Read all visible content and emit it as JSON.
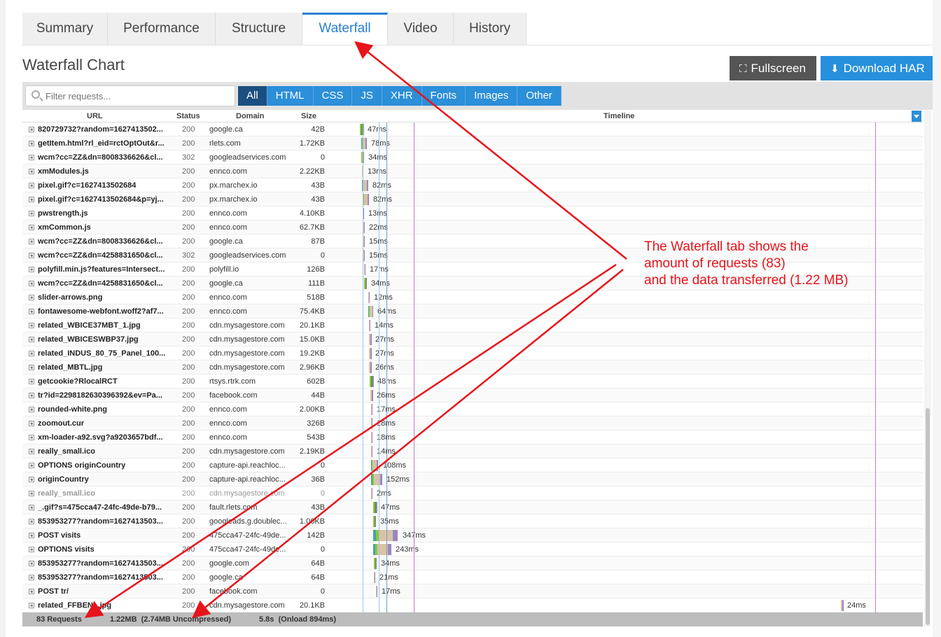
{
  "tabs": [
    {
      "label": "Summary",
      "active": false
    },
    {
      "label": "Performance",
      "active": false
    },
    {
      "label": "Structure",
      "active": false
    },
    {
      "label": "Waterfall",
      "active": true
    },
    {
      "label": "Video",
      "active": false
    },
    {
      "label": "History",
      "active": false
    }
  ],
  "page_title": "Waterfall Chart",
  "buttons": {
    "fullscreen": "Fullscreen",
    "download_har": "Download HAR"
  },
  "filter": {
    "placeholder": "Filter requests...",
    "types": [
      "All",
      "HTML",
      "CSS",
      "JS",
      "XHR",
      "Fonts",
      "Images",
      "Other"
    ],
    "active": "All"
  },
  "columns": {
    "url": "URL",
    "status": "Status",
    "domain": "Domain",
    "size": "Size",
    "timeline": "Timeline"
  },
  "requests": [
    {
      "url": "820729732?random=1627413502...",
      "status": "200",
      "domain": "google.ca",
      "size": "42B",
      "start": 0.05,
      "duration": "47ms"
    },
    {
      "url": "getItem.html?rl_eid=rctOptOut&r...",
      "status": "200",
      "domain": "rlets.com",
      "size": "1.72KB",
      "start": 0.052,
      "duration": "78ms"
    },
    {
      "url": "wcm?cc=ZZ&dn=8008336626&cl...",
      "status": "302",
      "domain": "googleadservices.com",
      "size": "0",
      "start": 0.052,
      "duration": "34ms"
    },
    {
      "url": "xmModules.js",
      "status": "200",
      "domain": "ennco.com",
      "size": "2.22KB",
      "start": 0.053,
      "duration": "13ms"
    },
    {
      "url": "pixel.gif?c=1627413502684",
      "status": "200",
      "domain": "px.marchex.io",
      "size": "43B",
      "start": 0.053,
      "duration": "82ms"
    },
    {
      "url": "pixel.gif?c=1627413502684&p=yj...",
      "status": "200",
      "domain": "px.marchex.io",
      "size": "43B",
      "start": 0.054,
      "duration": "82ms"
    },
    {
      "url": "pwstrength.js",
      "status": "200",
      "domain": "ennco.com",
      "size": "4.10KB",
      "start": 0.054,
      "duration": "13ms"
    },
    {
      "url": "xmCommon.js",
      "status": "200",
      "domain": "ennco.com",
      "size": "62.7KB",
      "start": 0.055,
      "duration": "22ms"
    },
    {
      "url": "wcm?cc=ZZ&dn=8008336626&cl...",
      "status": "200",
      "domain": "google.ca",
      "size": "87B",
      "start": 0.055,
      "duration": "15ms"
    },
    {
      "url": "wcm?cc=ZZ&dn=4258831650&cl...",
      "status": "302",
      "domain": "googleadservices.com",
      "size": "0",
      "start": 0.055,
      "duration": "15ms"
    },
    {
      "url": "polyfill.min.js?features=Intersect...",
      "status": "200",
      "domain": "polyfill.io",
      "size": "126B",
      "start": 0.057,
      "duration": "17ms"
    },
    {
      "url": "wcm?cc=ZZ&dn=4258831650&cl...",
      "status": "200",
      "domain": "google.ca",
      "size": "111B",
      "start": 0.057,
      "duration": "34ms"
    },
    {
      "url": "slider-arrows.png",
      "status": "200",
      "domain": "ennco.com",
      "size": "518B",
      "start": 0.064,
      "duration": "12ms"
    },
    {
      "url": "fontawesome-webfont.woff2?af7...",
      "status": "200",
      "domain": "ennco.com",
      "size": "75.4KB",
      "start": 0.064,
      "duration": "64ms"
    },
    {
      "url": "related_WBICE37MBT_1.jpg",
      "status": "200",
      "domain": "cdn.mysagestore.com",
      "size": "20.1KB",
      "start": 0.065,
      "duration": "14ms"
    },
    {
      "url": "related_WBICESWBP37.jpg",
      "status": "200",
      "domain": "cdn.mysagestore.com",
      "size": "15.0KB",
      "start": 0.065,
      "duration": "27ms"
    },
    {
      "url": "related_INDUS_80_75_Panel_100...",
      "status": "200",
      "domain": "cdn.mysagestore.com",
      "size": "19.2KB",
      "start": 0.065,
      "duration": "27ms"
    },
    {
      "url": "related_MBTL.jpg",
      "status": "200",
      "domain": "cdn.mysagestore.com",
      "size": "2.96KB",
      "start": 0.065,
      "duration": "26ms"
    },
    {
      "url": "getcookie?RlocalRCT",
      "status": "200",
      "domain": "rtsys.rtrk.com",
      "size": "602B",
      "start": 0.066,
      "duration": "48ms"
    },
    {
      "url": "tr?id=2298182630396392&ev=Pa...",
      "status": "200",
      "domain": "facebook.com",
      "size": "44B",
      "start": 0.067,
      "duration": "26ms"
    },
    {
      "url": "rounded-white.png",
      "status": "200",
      "domain": "ennco.com",
      "size": "2.00KB",
      "start": 0.068,
      "duration": "17ms"
    },
    {
      "url": "zoomout.cur",
      "status": "200",
      "domain": "ennco.com",
      "size": "326B",
      "start": 0.068,
      "duration": "18ms"
    },
    {
      "url": "xm-loader-a92.svg?a9203657bdf...",
      "status": "200",
      "domain": "ennco.com",
      "size": "543B",
      "start": 0.068,
      "duration": "18ms"
    },
    {
      "url": "really_small.ico",
      "status": "200",
      "domain": "cdn.mysagestore.com",
      "size": "2.19KB",
      "start": 0.068,
      "duration": "14ms"
    },
    {
      "url": "OPTIONS originCountry",
      "status": "200",
      "domain": "capture-api.reachloc...",
      "size": "0",
      "start": 0.069,
      "duration": "108ms"
    },
    {
      "url": "originCountry",
      "status": "200",
      "domain": "capture-api.reachloc...",
      "size": "36B",
      "start": 0.069,
      "duration": "152ms"
    },
    {
      "url": "really_small.ico",
      "status": "200",
      "domain": "cdn.mysagestore.com",
      "size": "0",
      "start": 0.069,
      "duration": "2ms",
      "dim": true
    },
    {
      "url": "_.gif?s=475cca47-24fc-49de-b79...",
      "status": "200",
      "domain": "fault.rlets.com",
      "size": "43B",
      "start": 0.072,
      "duration": "47ms"
    },
    {
      "url": "853953277?random=1627413503...",
      "status": "200",
      "domain": "googleads.g.doublec...",
      "size": "1.06KB",
      "start": 0.072,
      "duration": "35ms"
    },
    {
      "url": "POST visits",
      "status": "200",
      "domain": "475cca47-24fc-49de...",
      "size": "142B",
      "start": 0.072,
      "duration": "347ms"
    },
    {
      "url": "OPTIONS visits",
      "status": "200",
      "domain": "475cca47-24fc-49de...",
      "size": "0",
      "start": 0.072,
      "duration": "243ms"
    },
    {
      "url": "853953277?random=1627413503...",
      "status": "200",
      "domain": "google.com",
      "size": "64B",
      "start": 0.073,
      "duration": "34ms"
    },
    {
      "url": "853953277?random=1627413503...",
      "status": "200",
      "domain": "google.ca",
      "size": "64B",
      "start": 0.073,
      "duration": "21ms"
    },
    {
      "url": "POST tr/",
      "status": "200",
      "domain": "facebook.com",
      "size": "0",
      "start": 0.077,
      "duration": "17ms"
    },
    {
      "url": "related_FFBENL.jpg",
      "status": "200",
      "domain": "cdn.mysagestore.com",
      "size": "20.1KB",
      "start": 0.862,
      "duration": "24ms"
    }
  ],
  "footer": {
    "requests": "83 Requests",
    "transferred": "1.22MB  (2.74MB Uncompressed)",
    "load": "5.8s  (Onload 894ms)"
  },
  "annotation": {
    "lines": [
      "The Waterfall tab shows the",
      "amount of requests (83)",
      "and the data transferred (1.22 MB)"
    ],
    "color": "#e8141b"
  },
  "colors": {
    "accent": "#2a7fd4",
    "button_dark": "#555555",
    "button_blue": "#2790dc",
    "dns": "#3fa6a6",
    "connect": "#8dc63f",
    "wait": "#d8c3a5",
    "receive": "#9b87c0",
    "ssl": "#5a9a2a"
  }
}
